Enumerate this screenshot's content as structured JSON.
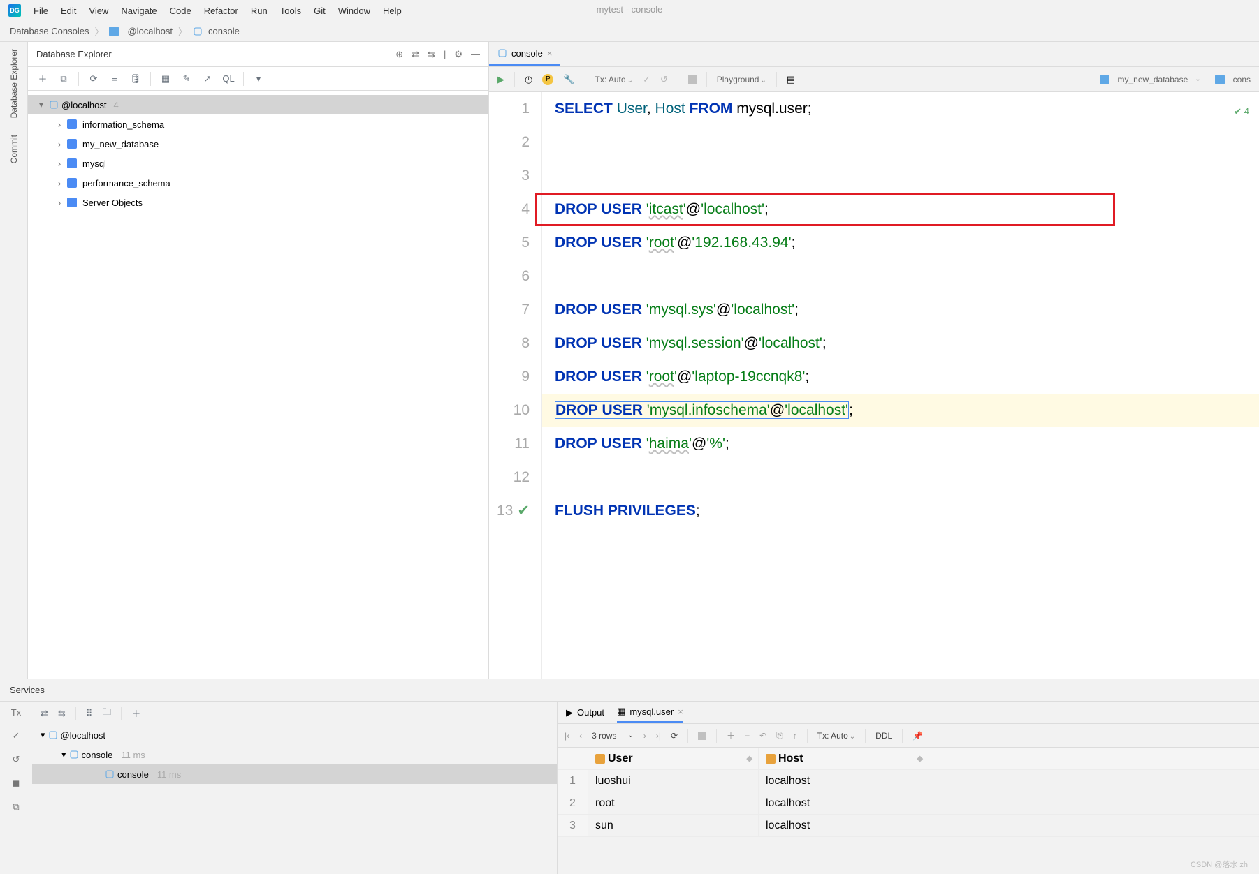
{
  "window_title": "mytest - console",
  "menubar": [
    "File",
    "Edit",
    "View",
    "Navigate",
    "Code",
    "Refactor",
    "Run",
    "Tools",
    "Git",
    "Window",
    "Help"
  ],
  "breadcrumbs": [
    "Database Consoles",
    "@localhost",
    "console"
  ],
  "db_explorer": {
    "title": "Database Explorer",
    "root": {
      "label": "@localhost",
      "count": "4"
    },
    "children": [
      "information_schema",
      "my_new_database",
      "mysql",
      "performance_schema",
      "Server Objects"
    ]
  },
  "editor_tab": "console",
  "editor_toolbar": {
    "tx": "Tx: Auto",
    "mode": "Playground",
    "context": "my_new_database",
    "ctx2": "cons"
  },
  "inspection": "4",
  "code": {
    "lines": [
      {
        "n": "1",
        "tokens": [
          [
            "kw",
            "SELECT"
          ],
          [
            "",
            ""
          ],
          [
            "ident",
            "User"
          ],
          [
            "punct",
            ", "
          ],
          [
            "ident",
            "Host"
          ],
          [
            "",
            ""
          ],
          [
            "kw",
            "FROM"
          ],
          [
            "",
            ""
          ],
          [
            "",
            "mysql.user"
          ],
          [
            "punct",
            ";"
          ]
        ]
      },
      {
        "n": "2",
        "tokens": []
      },
      {
        "n": "3",
        "tokens": []
      },
      {
        "n": "4",
        "tokens": [
          [
            "kw",
            "DROP"
          ],
          [
            "",
            ""
          ],
          [
            "kw",
            "USER"
          ],
          [
            "",
            ""
          ],
          [
            "str",
            "'"
          ],
          [
            "str u",
            "itcast"
          ],
          [
            "str",
            "'"
          ],
          [
            "punct",
            "@"
          ],
          [
            "str",
            "'localhost'"
          ],
          [
            "punct",
            ";"
          ]
        ]
      },
      {
        "n": "5",
        "tokens": [
          [
            "kw",
            "DROP"
          ],
          [
            "",
            ""
          ],
          [
            "kw",
            "USER"
          ],
          [
            "",
            ""
          ],
          [
            "str",
            "'"
          ],
          [
            "str u",
            "root"
          ],
          [
            "str",
            "'"
          ],
          [
            "punct",
            "@"
          ],
          [
            "str",
            "'192.168.43.94'"
          ],
          [
            "punct",
            ";"
          ]
        ]
      },
      {
        "n": "6",
        "tokens": []
      },
      {
        "n": "7",
        "tokens": [
          [
            "kw",
            "DROP"
          ],
          [
            "",
            ""
          ],
          [
            "kw",
            "USER"
          ],
          [
            "",
            ""
          ],
          [
            "str",
            "'mysql.sys'"
          ],
          [
            "punct",
            "@"
          ],
          [
            "str",
            "'localhost'"
          ],
          [
            "punct",
            ";"
          ]
        ]
      },
      {
        "n": "8",
        "tokens": [
          [
            "kw",
            "DROP"
          ],
          [
            "",
            ""
          ],
          [
            "kw",
            "USER"
          ],
          [
            "",
            ""
          ],
          [
            "str",
            "'mysql.session'"
          ],
          [
            "punct",
            "@"
          ],
          [
            "str",
            "'localhost'"
          ],
          [
            "punct",
            ";"
          ]
        ]
      },
      {
        "n": "9",
        "tokens": [
          [
            "kw",
            "DROP"
          ],
          [
            "",
            ""
          ],
          [
            "kw",
            "USER"
          ],
          [
            "",
            ""
          ],
          [
            "str",
            "'"
          ],
          [
            "str u",
            "root"
          ],
          [
            "str",
            "'"
          ],
          [
            "punct",
            "@"
          ],
          [
            "str",
            "'laptop-19ccnqk8'"
          ],
          [
            "punct",
            ";"
          ]
        ]
      },
      {
        "n": "10",
        "hl": true,
        "sel": true,
        "tokens": [
          [
            "kw",
            "DROP"
          ],
          [
            "",
            ""
          ],
          [
            "kw",
            "USER"
          ],
          [
            "",
            ""
          ],
          [
            "str",
            "'mysql.infoschema'"
          ],
          [
            "punct",
            "@"
          ],
          [
            "str",
            "'localhost'"
          ],
          [
            "punct",
            ";"
          ]
        ]
      },
      {
        "n": "11",
        "tokens": [
          [
            "kw",
            "DROP"
          ],
          [
            "",
            ""
          ],
          [
            "kw",
            "USER"
          ],
          [
            "",
            ""
          ],
          [
            "str",
            "'"
          ],
          [
            "str u",
            "haima"
          ],
          [
            "str",
            "'"
          ],
          [
            "punct",
            "@"
          ],
          [
            "str",
            "'%'"
          ],
          [
            "punct",
            ";"
          ]
        ]
      },
      {
        "n": "12",
        "tokens": []
      },
      {
        "n": "13",
        "check": true,
        "tokens": [
          [
            "kw",
            "FLUSH"
          ],
          [
            "",
            ""
          ],
          [
            "kw",
            "PRIVILEGES"
          ],
          [
            "punct",
            ";"
          ]
        ]
      }
    ]
  },
  "services": {
    "title": "Services",
    "tree": [
      {
        "label": "@localhost",
        "ind": 0
      },
      {
        "label": "console",
        "muted": "11 ms",
        "ind": 1
      },
      {
        "label": "console",
        "muted": "11 ms",
        "ind": 2,
        "sel": true
      }
    ],
    "result_tabs": [
      "Output",
      "mysql.user"
    ],
    "result_toolbar": {
      "rows": "3 rows",
      "tx": "Tx: Auto",
      "ddl": "DDL"
    },
    "columns": [
      "User",
      "Host"
    ],
    "rows": [
      {
        "i": "1",
        "User": "luoshui",
        "Host": "localhost"
      },
      {
        "i": "2",
        "User": "root",
        "Host": "localhost"
      },
      {
        "i": "3",
        "User": "sun",
        "Host": "localhost"
      }
    ]
  },
  "rails": [
    "Database Explorer",
    "Commit"
  ],
  "watermark": "CSDN @落水 zh"
}
